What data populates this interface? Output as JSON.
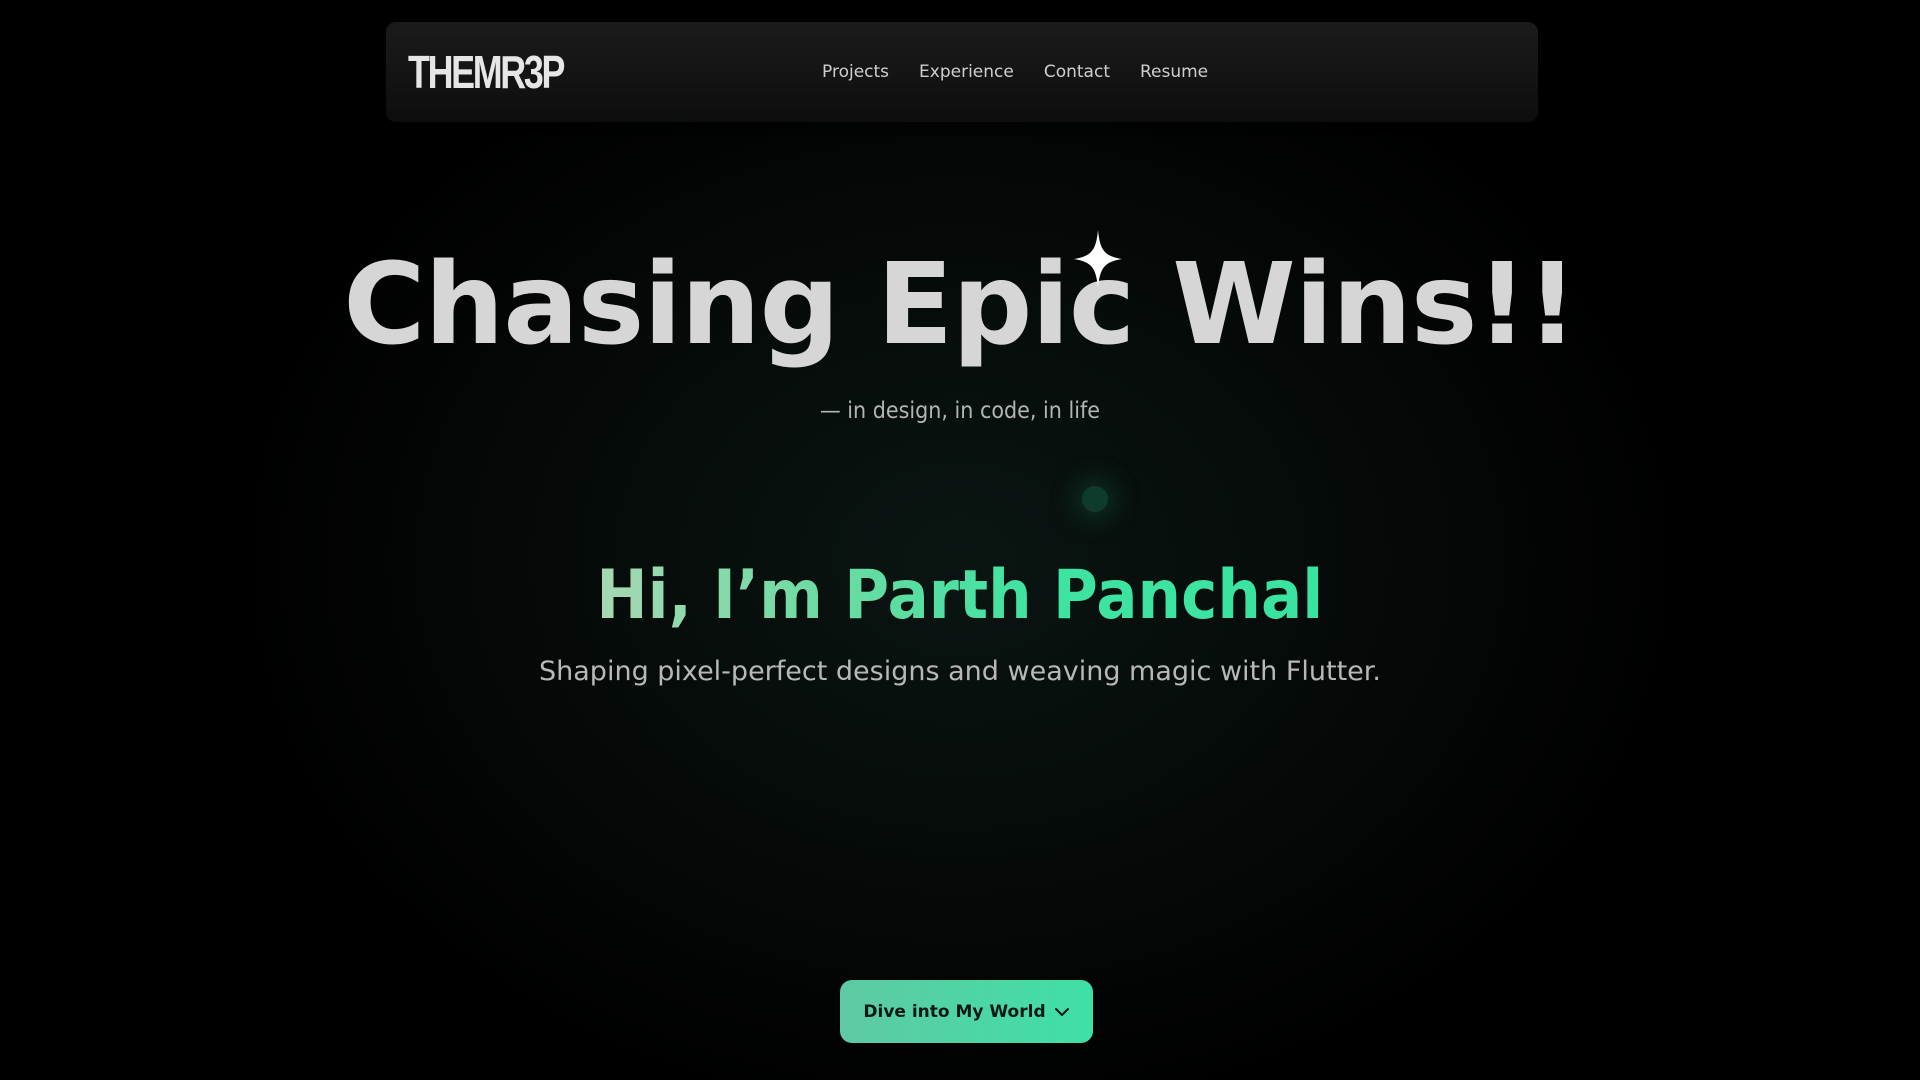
{
  "nav": {
    "logo_text": "THEMR3P",
    "links": [
      {
        "label": "Projects"
      },
      {
        "label": "Experience"
      },
      {
        "label": "Contact"
      },
      {
        "label": "Resume"
      }
    ]
  },
  "hero": {
    "title": "Chasing Epic Wins!!",
    "subtitle": "— in design, in code, in life",
    "greeting": "Hi, I’m Parth Panchal",
    "tagline": "Shaping pixel-perfect designs and weaving magic with Flutter."
  },
  "cta": {
    "label": "Dive into My World",
    "icon": "chevron-down-icon"
  },
  "colors": {
    "background": "#000000",
    "accent": "#3fe0a6",
    "title_text": "#d6d6d6"
  }
}
